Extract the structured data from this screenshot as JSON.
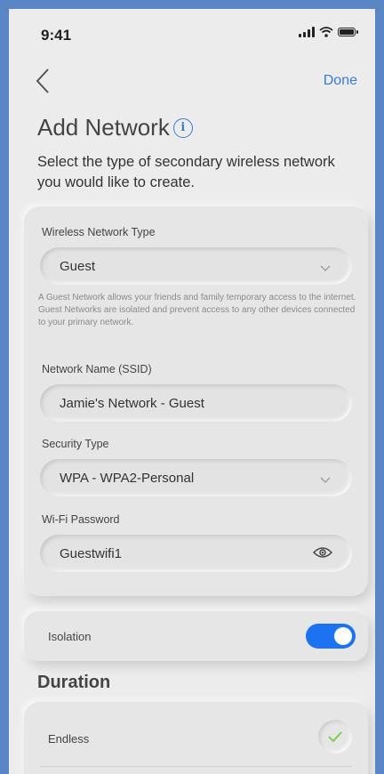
{
  "status_bar": {
    "time": "9:41"
  },
  "nav": {
    "done_label": "Done"
  },
  "header": {
    "title": "Add Network",
    "subtitle": "Select the type of secondary wireless network you would like to create."
  },
  "form": {
    "network_type": {
      "label": "Wireless Network Type",
      "value": "Guest"
    },
    "help_text": "A Guest Network allows your friends and family temporary access to the internet. Guest Networks are isolated and prevent access to any other devices connected to your primary network.",
    "ssid": {
      "label": "Network Name (SSID)",
      "value": "Jamie's Network - Guest"
    },
    "security": {
      "label": "Security Type",
      "value": "WPA - WPA2-Personal"
    },
    "password": {
      "label": "Wi-Fi Password",
      "value": "Guestwifi1"
    }
  },
  "isolation": {
    "label": "Isolation",
    "enabled": true
  },
  "duration": {
    "title": "Duration",
    "options": [
      {
        "label": "Endless",
        "selected": true
      }
    ]
  },
  "colors": {
    "accent": "#3a7bd5",
    "toggle_on": "#1d72f2",
    "check": "#7ac943",
    "background": "#ececec"
  }
}
